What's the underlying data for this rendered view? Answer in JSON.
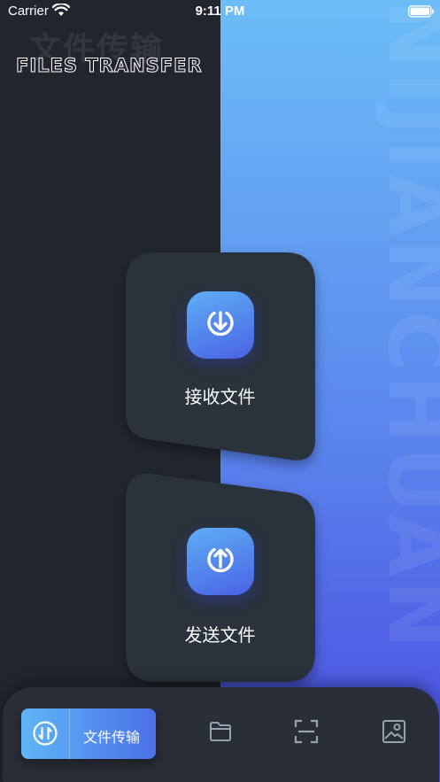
{
  "status_bar": {
    "carrier": "Carrier",
    "time": "9:11 PM"
  },
  "header": {
    "title_cn": "文件传输",
    "title_en": "FILES TRANSFER",
    "watermark": "NIJIANCHUAN"
  },
  "cards": [
    {
      "label": "接收文件",
      "icon": "download-icon"
    },
    {
      "label": "发送文件",
      "icon": "upload-icon"
    }
  ],
  "tab_bar": {
    "active_label": "文件传输",
    "items": [
      "transfer-icon",
      "folder-icon",
      "scan-icon",
      "image-icon"
    ]
  },
  "colors": {
    "dark_bg": "#21252d",
    "card_bg": "#2c303a",
    "accent_start": "#5fb6f6",
    "accent_end": "#4a4be0"
  }
}
